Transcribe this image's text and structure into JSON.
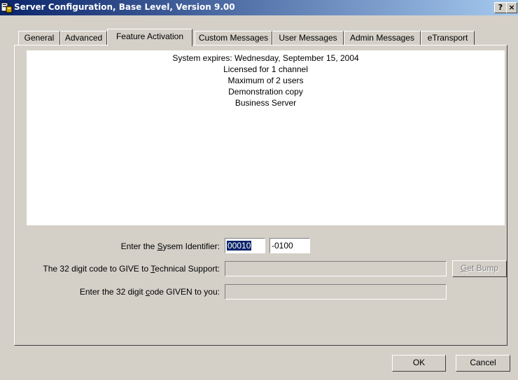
{
  "window": {
    "title": "Server Configuration, Base Level, Version 9.00",
    "help_label": "?",
    "close_label": "×"
  },
  "tabs": [
    {
      "label": "General"
    },
    {
      "label": "Advanced"
    },
    {
      "label": "Feature Activation"
    },
    {
      "label": "Custom Messages"
    },
    {
      "label": "User Messages"
    },
    {
      "label": "Admin Messages"
    },
    {
      "label": "eTransport"
    }
  ],
  "info": [
    "System expires: Wednesday, September 15, 2004",
    "Licensed for 1 channel",
    "Maximum of 2 users",
    "Demonstration copy",
    "Business Server"
  ],
  "form": {
    "system_id": {
      "label_pre": "Enter the ",
      "label_ul": "S",
      "label_post": "ysem Identifier:",
      "value1": "00010",
      "value2": "-0100"
    },
    "give_code": {
      "label_pre": "The 32 digit code to GIVE to ",
      "label_ul": "T",
      "label_post": "echnical Support:",
      "value": ""
    },
    "given_code": {
      "label_pre": "Enter the 32 digit ",
      "label_ul": "c",
      "label_post": "ode GIVEN to you:",
      "value": ""
    },
    "bump": {
      "label_ul": "G",
      "label_post": "et Bump"
    }
  },
  "buttons": {
    "ok": "OK",
    "cancel": "Cancel"
  }
}
